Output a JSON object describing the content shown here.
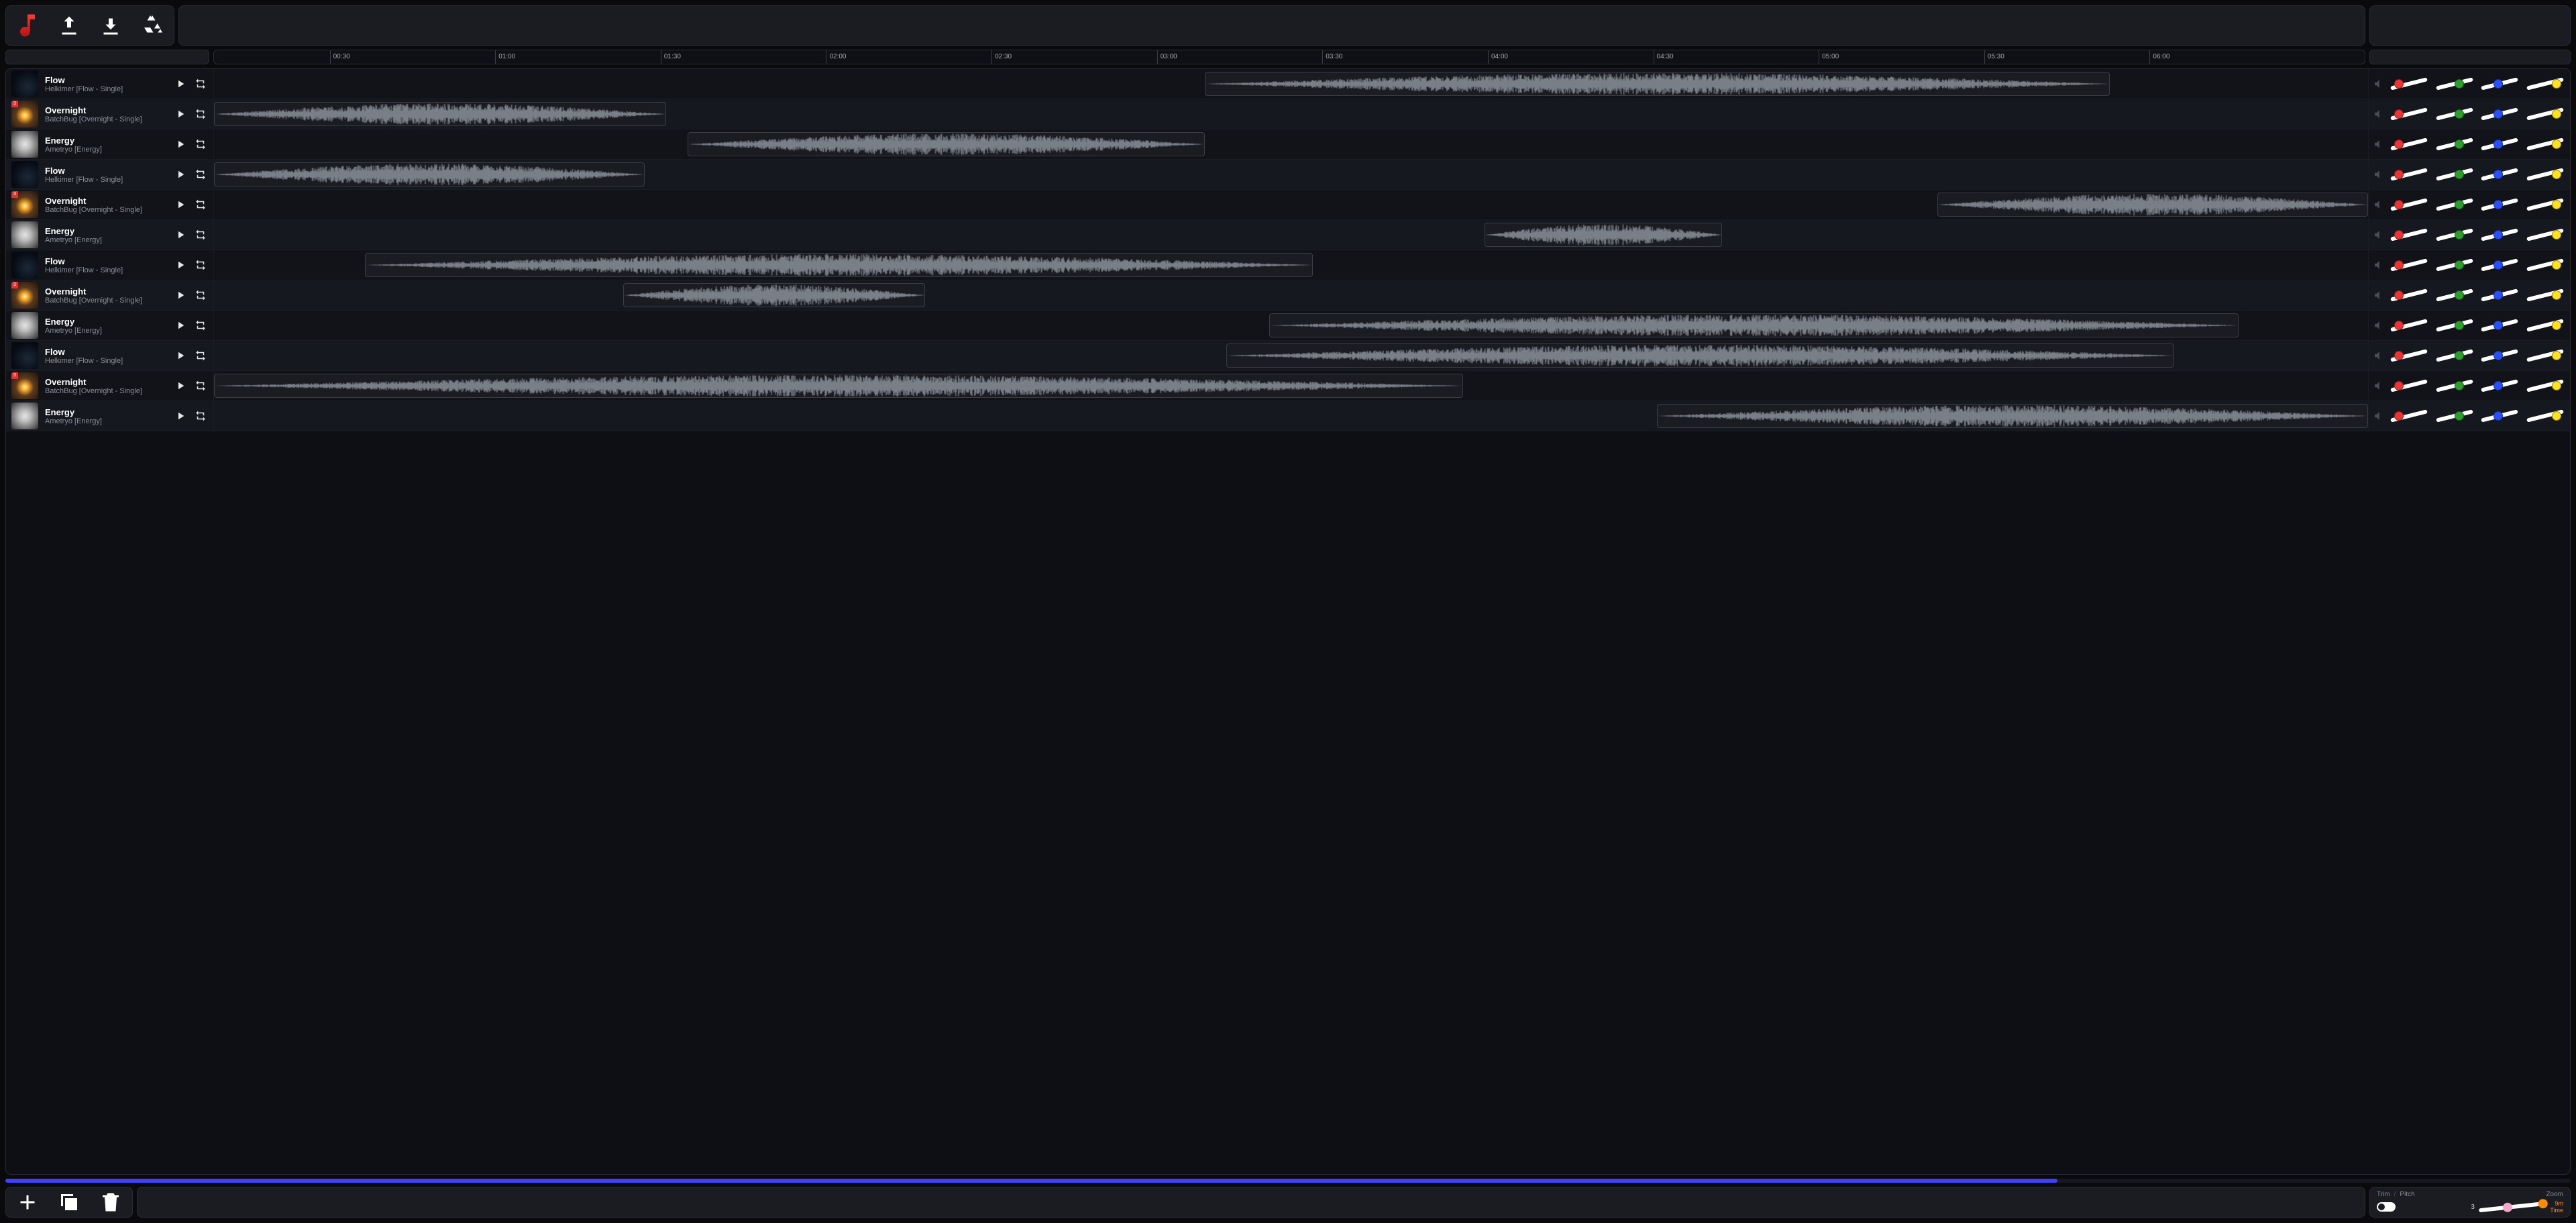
{
  "timeline": {
    "ticks": [
      "00:30",
      "01:00",
      "01:30",
      "02:00",
      "02:30",
      "03:00",
      "03:30",
      "04:00",
      "04:30",
      "05:00",
      "05:30",
      "06:00"
    ],
    "total_seconds": 400
  },
  "tracks": [
    {
      "title": "Flow",
      "artist": "Helkimer [Flow - Single]",
      "art": "dark",
      "clip": {
        "start": 46,
        "len": 42
      }
    },
    {
      "title": "Overnight",
      "artist": "BatchBug [Overnight - Single]",
      "art": "sun",
      "clip": {
        "start": 0,
        "len": 21
      }
    },
    {
      "title": "Energy",
      "artist": "Ametryo [Energy]",
      "art": "bw",
      "clip": {
        "start": 22,
        "len": 24
      }
    },
    {
      "title": "Flow",
      "artist": "Helkimer [Flow - Single]",
      "art": "dark",
      "clip": {
        "start": 0,
        "len": 20
      }
    },
    {
      "title": "Overnight",
      "artist": "BatchBug [Overnight - Single]",
      "art": "sun",
      "clip": {
        "start": 80,
        "len": 20
      }
    },
    {
      "title": "Energy",
      "artist": "Ametryo [Energy]",
      "art": "bw",
      "clip": {
        "start": 59,
        "len": 11
      }
    },
    {
      "title": "Flow",
      "artist": "Helkimer [Flow - Single]",
      "art": "dark",
      "clip": {
        "start": 7,
        "len": 44
      }
    },
    {
      "title": "Overnight",
      "artist": "BatchBug [Overnight - Single]",
      "art": "sun",
      "clip": {
        "start": 19,
        "len": 14
      }
    },
    {
      "title": "Energy",
      "artist": "Ametryo [Energy]",
      "art": "bw",
      "clip": {
        "start": 49,
        "len": 45
      }
    },
    {
      "title": "Flow",
      "artist": "Helkimer [Flow - Single]",
      "art": "dark",
      "clip": {
        "start": 47,
        "len": 44
      }
    },
    {
      "title": "Overnight",
      "artist": "BatchBug [Overnight - Single]",
      "art": "sun",
      "clip": {
        "start": 0,
        "len": 58
      }
    },
    {
      "title": "Energy",
      "artist": "Ametryo [Energy]",
      "art": "bw",
      "clip": {
        "start": 67,
        "len": 33
      }
    }
  ],
  "hscroll": {
    "thumb_pct": 80
  },
  "footer": {
    "trim_label": "Trim",
    "pitch_label": "Pitch",
    "zoom_label": "Zoom",
    "zoom_value": "3",
    "time_label": "Time",
    "time_value": "9m",
    "zoom_knob1_pct": 43,
    "zoom_knob2_pct": 96
  },
  "slider_defaults": {
    "red": 26,
    "green": 62,
    "blue": 48,
    "yellow": 78
  }
}
